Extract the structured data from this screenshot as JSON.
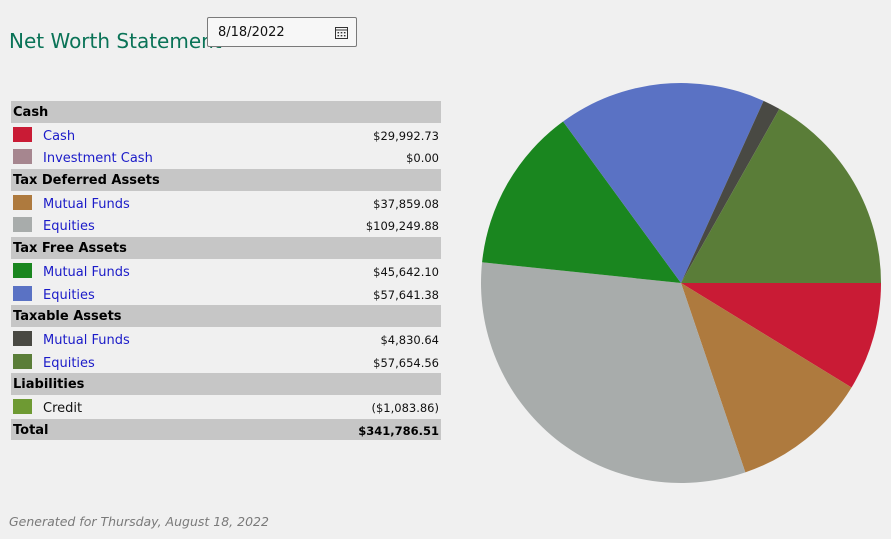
{
  "header": {
    "title": "Net Worth Statement",
    "date_value": "8/18/2022"
  },
  "table": {
    "sections": [
      {
        "label": "Cash",
        "items": [
          {
            "label": "Cash",
            "amount": "$29,992.73",
            "color": "#c91b35",
            "link": true
          },
          {
            "label": "Investment Cash",
            "amount": "$0.00",
            "color": "#a6868f",
            "link": true
          }
        ]
      },
      {
        "label": "Tax Deferred Assets",
        "items": [
          {
            "label": "Mutual Funds",
            "amount": "$37,859.08",
            "color": "#ae7a3e",
            "link": true
          },
          {
            "label": "Equities",
            "amount": "$109,249.88",
            "color": "#a8acab",
            "link": true
          }
        ]
      },
      {
        "label": "Tax Free Assets",
        "items": [
          {
            "label": "Mutual Funds",
            "amount": "$45,642.10",
            "color": "#1a861f",
            "link": true
          },
          {
            "label": "Equities",
            "amount": "$57,641.38",
            "color": "#5a72c4",
            "link": true
          }
        ]
      },
      {
        "label": "Taxable Assets",
        "items": [
          {
            "label": "Mutual Funds",
            "amount": "$4,830.64",
            "color": "#494943",
            "link": true
          },
          {
            "label": "Equities",
            "amount": "$57,654.56",
            "color": "#5a7d38",
            "link": true
          }
        ]
      },
      {
        "label": "Liabilities",
        "items": [
          {
            "label": "Credit",
            "amount": "($1,083.86)",
            "color": "#6e9a33",
            "link": false
          }
        ]
      }
    ],
    "total_label": "Total",
    "total_amount": "$341,786.51"
  },
  "chart_data": {
    "type": "pie",
    "start": "3 o'clock",
    "direction": "clockwise",
    "slices": [
      {
        "label": "Cash",
        "value": 29992.73,
        "color": "#c91b35"
      },
      {
        "label": "Tax Deferred Mutual Funds",
        "value": 37859.08,
        "color": "#ae7a3e"
      },
      {
        "label": "Tax Deferred Equities",
        "value": 109249.88,
        "color": "#a8acab"
      },
      {
        "label": "Tax Free Mutual Funds",
        "value": 45642.1,
        "color": "#1a861f"
      },
      {
        "label": "Tax Free Equities",
        "value": 57641.38,
        "color": "#5a72c4"
      },
      {
        "label": "Taxable Mutual Funds",
        "value": 4830.64,
        "color": "#494943"
      },
      {
        "label": "Taxable Equities",
        "value": 57654.56,
        "color": "#5a7d38"
      }
    ]
  },
  "footer": {
    "text": "Generated for Thursday, August 18, 2022"
  }
}
